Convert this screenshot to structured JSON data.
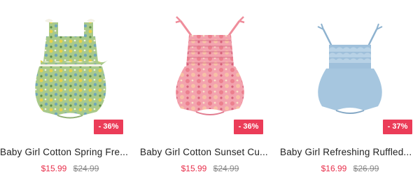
{
  "products": [
    {
      "title": "Baby Girl Cotton Spring Fre...",
      "sale_price": "$15.99",
      "original_price": "$24.99",
      "discount_badge": "- 36%",
      "image_icon": "green-floral-romper-image"
    },
    {
      "title": "Baby Girl Cotton Sunset Cu...",
      "sale_price": "$15.99",
      "original_price": "$24.99",
      "discount_badge": "- 36%",
      "image_icon": "pink-floral-romper-image"
    },
    {
      "title": "Baby Girl Refreshing Ruffled...",
      "sale_price": "$16.99",
      "original_price": "$26.99",
      "discount_badge": "- 37%",
      "image_icon": "denim-ruffled-romper-image"
    }
  ],
  "colors": {
    "badge_bg": "#eb3c58",
    "sale_price": "#e8304c",
    "original_price": "#888888"
  }
}
